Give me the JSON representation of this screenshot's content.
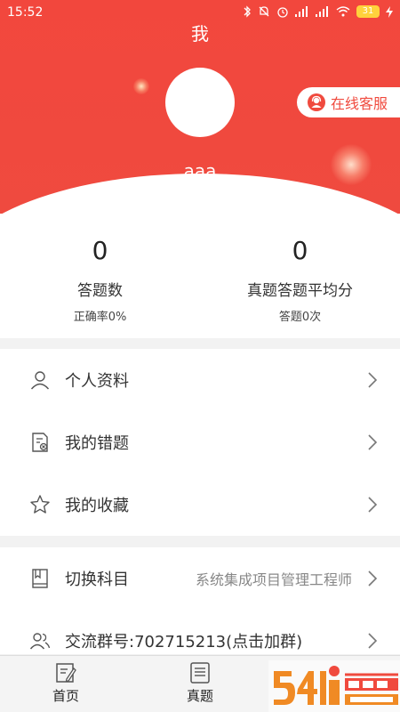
{
  "status_bar": {
    "time": "15:52",
    "battery": "31"
  },
  "header": {
    "title": "我",
    "username": "aaa",
    "service_button": "在线客服"
  },
  "stats": [
    {
      "value": "0",
      "label": "答题数",
      "sub": "正确率0%"
    },
    {
      "value": "0",
      "label": "真题答题平均分",
      "sub": "答题0次"
    }
  ],
  "menu_primary": [
    {
      "label": "个人资料",
      "icon": "user-icon"
    },
    {
      "label": "我的错题",
      "icon": "error-book-icon"
    },
    {
      "label": "我的收藏",
      "icon": "star-icon"
    }
  ],
  "menu_secondary": [
    {
      "label": "切换科目",
      "value": "系统集成项目管理工程师",
      "icon": "book-icon"
    },
    {
      "label": "交流群号:702715213(点击加群)",
      "icon": "group-icon"
    }
  ],
  "tabbar": [
    {
      "label": "首页",
      "icon": "home-edit-icon"
    },
    {
      "label": "真题",
      "icon": "paper-icon"
    }
  ],
  "colors": {
    "brand_red": "#f04a3e",
    "watermark_orange": "#f08a24"
  }
}
